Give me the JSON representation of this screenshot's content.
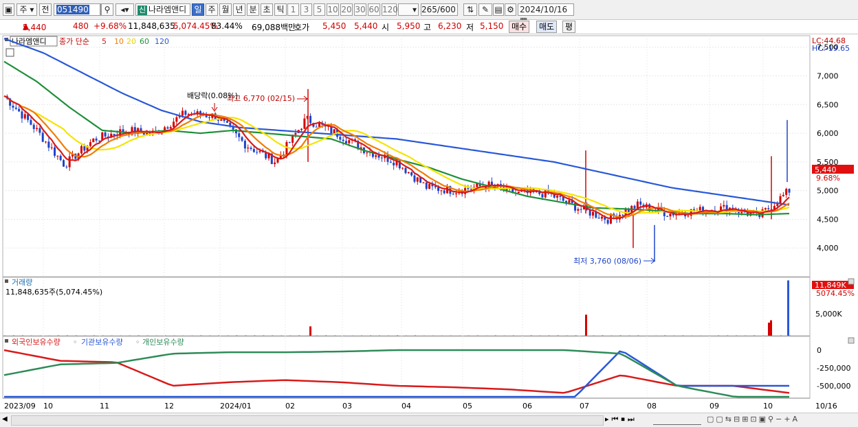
{
  "toolbar": {
    "period_ju": "주",
    "mode": "전",
    "stock_code": "051490",
    "badge": "신",
    "stock_name": "나라엠앤디",
    "period_buttons": [
      "일",
      "주",
      "월",
      "년",
      "분",
      "초",
      "틱"
    ],
    "active_period": "일",
    "interval_buttons": [
      "1",
      "3",
      "5",
      "10",
      "20",
      "30",
      "60",
      "120"
    ],
    "count": "265",
    "count_total": "/600",
    "date": "2024/10/16"
  },
  "quote": {
    "price": "5,440",
    "change": "480",
    "change_pct": "+9.68%",
    "volume": "11,848,635",
    "volume_ratio": "5,074.45%",
    "turnover_pct": "83.44%",
    "amount": "69,088백만",
    "hoga_label": "호가",
    "ask": "5,450",
    "bid": "5,440",
    "open_label": "시",
    "open": "5,950",
    "high_label": "고",
    "high": "6,230",
    "low_label": "저",
    "low": "5,150",
    "buy_label": "매수",
    "sell_label": "매도",
    "eval_label": "평"
  },
  "price_panel": {
    "stock_tag": "나라엠앤디",
    "legend_prefix": "종가 단순",
    "ma_labels": [
      "5",
      "10",
      "20",
      "60",
      "120"
    ],
    "lc": "LC:44.68",
    "hc": "HC:-19.65",
    "current_price": "5,440",
    "current_pct": "9.68%",
    "dividend_label": "배당락(0.08%)",
    "high_annot": "최고 6,770 (02/15)",
    "low_annot": "최저 3,760 (08/06)"
  },
  "volume_panel": {
    "title": "거래량",
    "value_text": "11,848,635주(5,074.45%)",
    "current_value": "11,849K",
    "current_pct": "5074.45%",
    "axis_label": "5,000K"
  },
  "holders_panel": {
    "legend": [
      "외국인보유수량",
      "기관보유수량",
      "개인보유수량"
    ],
    "y_ticks": [
      "0",
      "-250,000",
      "-500,000"
    ]
  },
  "x_axis": {
    "labels": [
      "2023/09",
      "10",
      "11",
      "12",
      "2024/01",
      "02",
      "03",
      "04",
      "05",
      "06",
      "07",
      "08",
      "09",
      "10",
      "10/16"
    ]
  },
  "colors": {
    "ma5": "#d81a1a",
    "ma10": "#f07d00",
    "ma20": "#f5e400",
    "ma60": "#1f8f3a",
    "ma120": "#2858d8",
    "up": "#d40000",
    "down": "#1e44c8",
    "foreign": "#d81a1a",
    "institution": "#2858d8",
    "individual": "#2e8b57"
  },
  "chart_data": [
    {
      "type": "line",
      "title": "",
      "x_range": [
        "2023/09",
        "2024/10/16"
      ],
      "ylim": [
        3500,
        7700
      ],
      "y_ticks": [
        4000,
        4500,
        5000,
        5500,
        6000,
        6500,
        7000,
        7500
      ],
      "series": [
        {
          "name": "5",
          "values_approx": [
            6650,
            6100,
            5450,
            5900,
            6050,
            6000,
            6350,
            6300,
            5800,
            5500,
            6250,
            6000,
            5700,
            5500,
            5050,
            5000,
            5100,
            4950,
            4950,
            4700,
            4500,
            4750,
            4600,
            4650,
            4700,
            4550,
            5000
          ]
        },
        {
          "name": "60",
          "values_approx": [
            7250,
            6900,
            6450,
            6050,
            6000,
            6050,
            6000,
            6050,
            6000,
            5950,
            5900,
            5700,
            5550,
            5400,
            5200,
            5050,
            4900,
            4800,
            4700,
            4680,
            4650,
            4600,
            4600,
            4580,
            4600
          ]
        },
        {
          "name": "120",
          "values_approx": [
            7650,
            7400,
            7050,
            6700,
            6400,
            6200,
            6100,
            6050,
            6000,
            5950,
            5900,
            5800,
            5700,
            5600,
            5500,
            5350,
            5200,
            5050,
            4950,
            4850,
            4750
          ]
        }
      ],
      "annotations": [
        {
          "text": "최고 6,770 (02/15)",
          "value": 6770
        },
        {
          "text": "최저 3,760 (08/06)",
          "value": 3760
        }
      ],
      "current": {
        "value": 5440,
        "pct": "9.68%"
      }
    },
    {
      "type": "bar",
      "title": "거래량",
      "current_value": "11,849K",
      "y_ticks": [
        "5,000K"
      ],
      "spikes_K": [
        {
          "at": "2024/02",
          "v": 2000
        },
        {
          "at": "2024/07",
          "v": 4500
        },
        {
          "at": "2024/10",
          "v": 3300
        },
        {
          "at": "2024/10/16",
          "v": 11849
        }
      ]
    },
    {
      "type": "line",
      "title": "",
      "y_ticks": [
        0,
        -250000,
        -500000
      ],
      "series": [
        {
          "name": "외국인보유수량",
          "values_approx": [
            0,
            -150000,
            -170000,
            -500000,
            -450000,
            -420000,
            -450000,
            -500000,
            -520000,
            -550000,
            -600000,
            -350000,
            -500000,
            -500000,
            -600000
          ]
        },
        {
          "name": "기관보유수량",
          "values_approx": [
            -750000,
            -750000,
            -750000,
            -750000,
            -800000,
            -800000,
            -800000,
            -800000,
            -800000,
            -800000,
            -800000,
            0,
            -500000,
            -500000,
            -500000
          ]
        },
        {
          "name": "개인보유수량",
          "values_approx": [
            -350000,
            -200000,
            -180000,
            -50000,
            -30000,
            -30000,
            -20000,
            0,
            0,
            0,
            0,
            -50000,
            -500000,
            -650000,
            -800000
          ]
        }
      ]
    }
  ]
}
